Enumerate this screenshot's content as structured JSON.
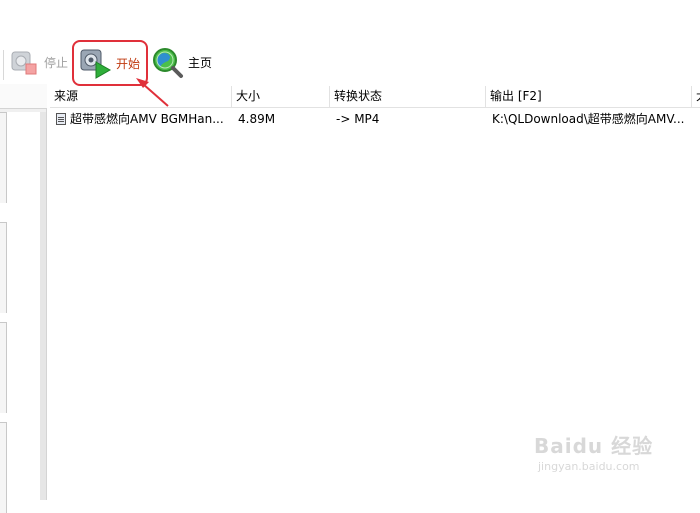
{
  "toolbar": {
    "stop_label": "停止",
    "start_label": "开始",
    "home_label": "主页"
  },
  "columns": [
    "来源",
    "大小",
    "转换状态",
    "输出 [F2]",
    "大"
  ],
  "rows": [
    {
      "source": "超带感燃向AMV BGMHan...",
      "size": "4.89M",
      "status": "-> MP4",
      "output": "K:\\QLDownload\\超带感燃向AMV..."
    }
  ],
  "watermark": {
    "brand": "Baidu 经验",
    "url": "jingyan.baidu.com"
  },
  "colors": {
    "highlight_border": "#e0303a",
    "start_label": "#c03a10",
    "disabled_label": "#a0a0a0"
  },
  "icons": [
    "stop-convert-icon",
    "start-convert-icon",
    "home-magnifier-icon",
    "file-icon"
  ]
}
